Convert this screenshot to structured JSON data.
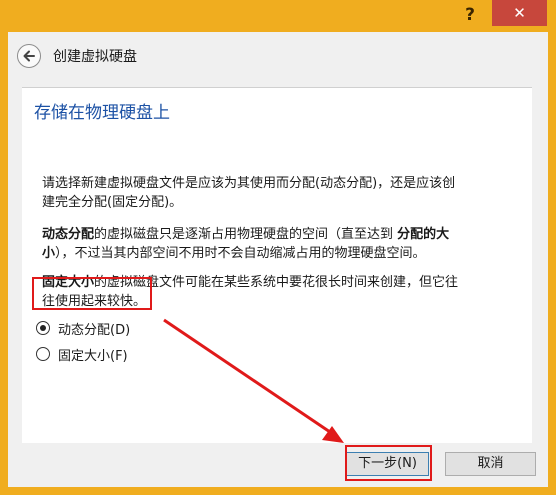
{
  "window": {
    "help_label": "?",
    "close_label": "✕"
  },
  "wizard": {
    "title": "创建虚拟硬盘",
    "back_icon": "back-arrow-icon"
  },
  "page": {
    "heading": "存储在物理硬盘上",
    "intro_line1": "请选择新建虚拟硬盘文件是应该为其使用而分配(动态分配)，还是应该创",
    "intro_line2": "建完全分配(固定分配)。",
    "dynamic_desc_bold1": "动态分配",
    "dynamic_desc_text1": "的虚拟磁盘只是逐渐占用物理硬盘的空间（直至达到",
    "dynamic_desc_bold2": "分配的大",
    "dynamic_desc_bold3": "小",
    "dynamic_desc_text2": "），不过当其内部空间不用时不会自动缩减占用的物理硬盘空间。",
    "fixed_desc_bold": "固定大小",
    "fixed_desc_text1": "的虚拟磁盘文件可能在某些系统中要花很长时间来创建，但它往",
    "fixed_desc_text2": "往使用起来较快。"
  },
  "options": [
    {
      "label": "动态分配(D)",
      "checked": true
    },
    {
      "label": "固定大小(F)",
      "checked": false
    }
  ],
  "buttons": {
    "next_label": "下一步(N)",
    "cancel_label": "取消"
  },
  "colors": {
    "title_bar": "#f0ad1f",
    "close_button": "#c7473c",
    "heading": "#1d52a5",
    "highlight": "#e01a1a"
  }
}
